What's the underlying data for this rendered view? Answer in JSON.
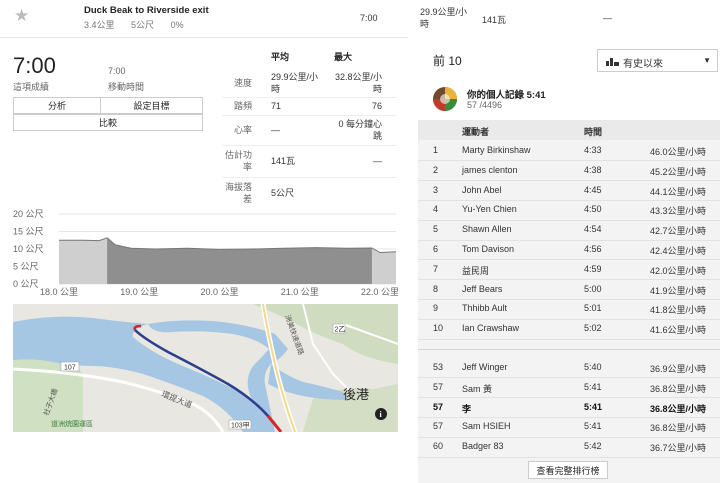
{
  "header": {
    "segment_title": "Duck Beak to Riverside exit",
    "distance": "3.4公里",
    "elevation": "5公尺",
    "grade": "0%",
    "time": "7:00",
    "speed": "29.9公里/小時",
    "power": "141瓦",
    "dash": "—"
  },
  "effort": {
    "elapsed_time": "7:00",
    "elapsed_label": "這項成績",
    "moving_time": "7:00",
    "moving_label": "移動時間",
    "analyze_label": "分析",
    "goal_label": "設定目標",
    "compare_label": "比較"
  },
  "stats": {
    "col_avg": "平均",
    "col_max": "最大",
    "rows": [
      {
        "label": "速度",
        "avg": "29.9公里/小時",
        "max": "32.8公里/小時"
      },
      {
        "label": "踏頻",
        "avg": "71",
        "max": "76"
      },
      {
        "label": "心率",
        "avg": "—",
        "max": "0 每分鐘心跳"
      },
      {
        "label": "估計功率",
        "avg": "141瓦",
        "max": "—"
      },
      {
        "label": "海拔落差",
        "avg": "5公尺",
        "max": ""
      }
    ]
  },
  "chart_data": {
    "type": "area",
    "ylabels": [
      "20 公尺",
      "15 公尺",
      "10 公尺",
      "5 公尺",
      "0 公尺"
    ],
    "xlabels": [
      "18.0 公里",
      "19.0 公里",
      "20.0 公里",
      "21.0 公里",
      "22.0 公里"
    ],
    "ylim": [
      0,
      20
    ],
    "xlim": [
      18.0,
      22.2
    ],
    "highlight_range": [
      18.6,
      21.9
    ],
    "x": [
      18.0,
      18.3,
      18.5,
      18.6,
      18.7,
      18.9,
      19.2,
      19.6,
      20.0,
      20.4,
      20.8,
      21.2,
      21.6,
      21.9,
      22.0,
      22.2
    ],
    "y": [
      12.5,
      12.5,
      12.4,
      13.2,
      11.2,
      10.2,
      10.0,
      10.2,
      9.9,
      10.0,
      10.2,
      10.4,
      10.2,
      10.3,
      9.0,
      9.2
    ]
  },
  "map": {
    "label_houzhu": "後港",
    "road_107": "107",
    "road_103": "103甲",
    "road_2z": "2乙",
    "label_road": "環提大道",
    "label_park": "道洲烷園運區",
    "label_expressway": "洲美快速道路",
    "label_bridge": "社子大橋",
    "info_icon": "info-icon",
    "route_color": "#2c3f8e",
    "route_highlight": "#d9262c"
  },
  "leaderboard": {
    "title": "前 10",
    "filter_label": "有史以來",
    "pr_title": "你的個人記錄 5:41",
    "pr_rank": "57 /4496",
    "col_athlete": "運動者",
    "col_time": "時間",
    "rows": [
      {
        "rank": "1",
        "name": "Marty Birkinshaw",
        "time": "4:33",
        "speed": "46.0公里/小時"
      },
      {
        "rank": "2",
        "name": "james clenton",
        "time": "4:38",
        "speed": "45.2公里/小時"
      },
      {
        "rank": "3",
        "name": "John Abel",
        "time": "4:45",
        "speed": "44.1公里/小時"
      },
      {
        "rank": "4",
        "name": "Yu-Yen Chien",
        "time": "4:50",
        "speed": "43.3公里/小時"
      },
      {
        "rank": "5",
        "name": "Shawn Allen",
        "time": "4:54",
        "speed": "42.7公里/小時"
      },
      {
        "rank": "6",
        "name": "Tom Davison",
        "time": "4:56",
        "speed": "42.4公里/小時"
      },
      {
        "rank": "7",
        "name": "益民周",
        "time": "4:59",
        "speed": "42.0公里/小時"
      },
      {
        "rank": "8",
        "name": "Jeff Bears",
        "time": "5:00",
        "speed": "41.9公里/小時"
      },
      {
        "rank": "9",
        "name": "Thhibb Ault",
        "time": "5:01",
        "speed": "41.8公里/小時"
      },
      {
        "rank": "10",
        "name": "Ian Crawshaw",
        "time": "5:02",
        "speed": "41.6公里/小時"
      }
    ],
    "nearby": [
      {
        "rank": "53",
        "name": "Jeff Winger",
        "time": "5:40",
        "speed": "36.9公里/小時",
        "me": false
      },
      {
        "rank": "57",
        "name": "Sam 黃",
        "time": "5:41",
        "speed": "36.8公里/小時",
        "me": false
      },
      {
        "rank": "57",
        "name": "李",
        "time": "5:41",
        "speed": "36.8公里/小時",
        "me": true
      },
      {
        "rank": "57",
        "name": "Sam HSIEH",
        "time": "5:41",
        "speed": "36.8公里/小時",
        "me": false
      },
      {
        "rank": "60",
        "name": "Badger 83",
        "time": "5:42",
        "speed": "36.7公里/小時",
        "me": false
      }
    ],
    "full_label": "查看完整排行榜"
  }
}
